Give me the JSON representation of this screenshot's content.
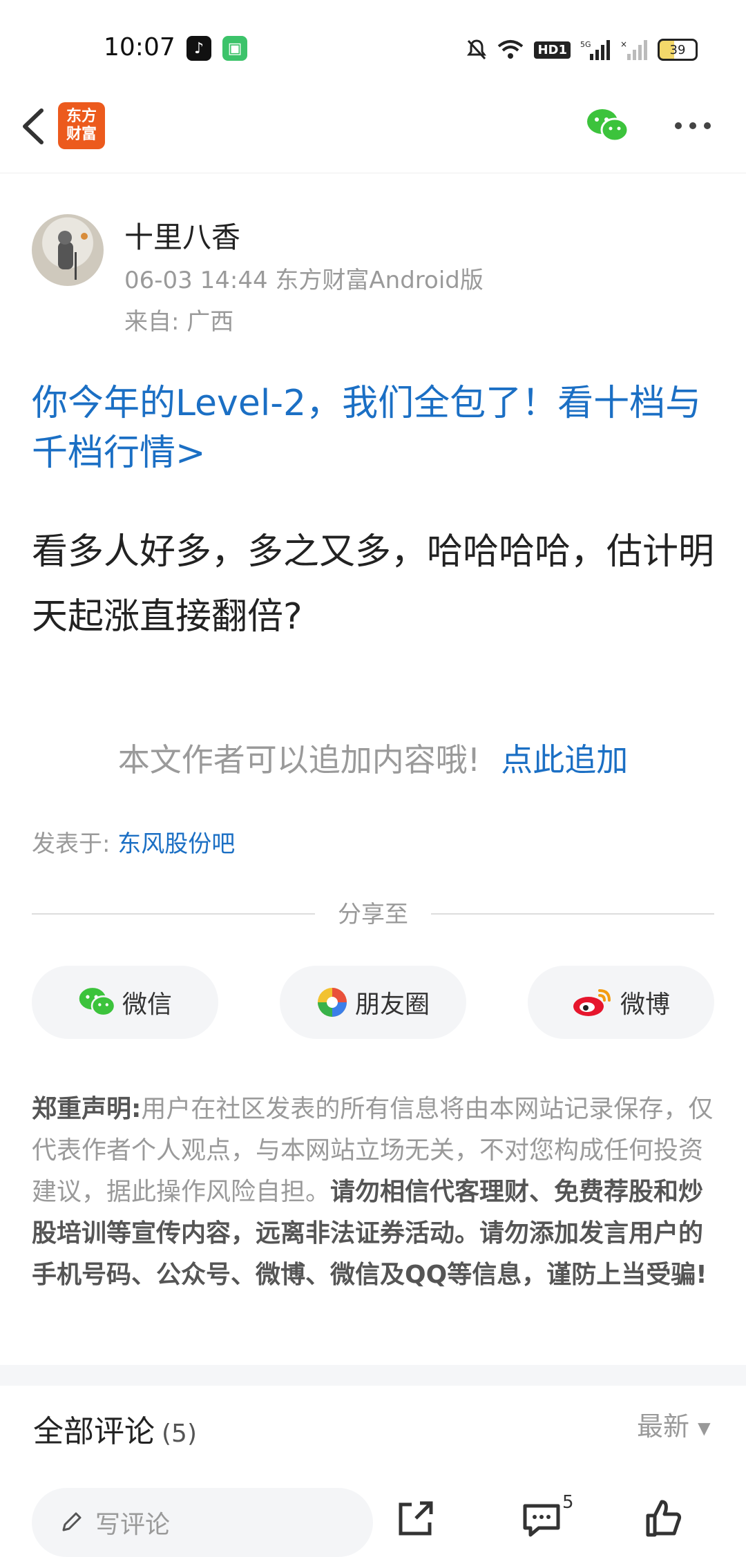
{
  "status_bar": {
    "time": "10:07",
    "battery": "39",
    "icons": [
      "tiktok-icon",
      "message-app-icon",
      "mute-icon",
      "wifi-icon",
      "hd-icon",
      "signal-5g-icon",
      "signal-icon",
      "battery-icon"
    ]
  },
  "nav": {
    "logo_line1": "东方",
    "logo_line2": "财富",
    "icons": [
      "back-icon",
      "wechat-icon",
      "more-icon"
    ]
  },
  "post": {
    "author": "十里八香",
    "meta": "06-03 14:44 东方财富Android版",
    "location": "来自: 广西",
    "promo": "你今年的Level-2，我们全包了！看十档与千档行情>",
    "body": "看多人好多，多之又多，哈哈哈哈，估计明天起涨直接翻倍?",
    "append_text": "本文作者可以追加内容哦!",
    "append_link": "点此追加",
    "posted_label": "发表于:",
    "posted_bar": "东风股份吧"
  },
  "share": {
    "title": "分享至",
    "buttons": [
      {
        "label": "微信",
        "icon": "wechat-icon"
      },
      {
        "label": "朋友圈",
        "icon": "moments-icon"
      },
      {
        "label": "微博",
        "icon": "weibo-icon"
      }
    ]
  },
  "disclaimer": {
    "label": "郑重声明:",
    "text": "用户在社区发表的所有信息将由本网站记录保存，仅代表作者个人观点，与本网站立场无关，不对您构成任何投资建议，据此操作风险自担。",
    "bold": "请勿相信代客理财、免费荐股和炒股培训等宣传内容，远离非法证券活动。请勿添加发言用户的手机号码、公众号、微博、微信及QQ等信息，谨防上当受骗!"
  },
  "comments": {
    "title": "全部评论",
    "count": "(5)",
    "sort": "最新",
    "write_placeholder": "写评论",
    "comment_badge": "5"
  },
  "colors": {
    "link_blue": "#1b6fc4",
    "logo_orange": "#ec5a1d",
    "wechat_green": "#3cc33c"
  }
}
